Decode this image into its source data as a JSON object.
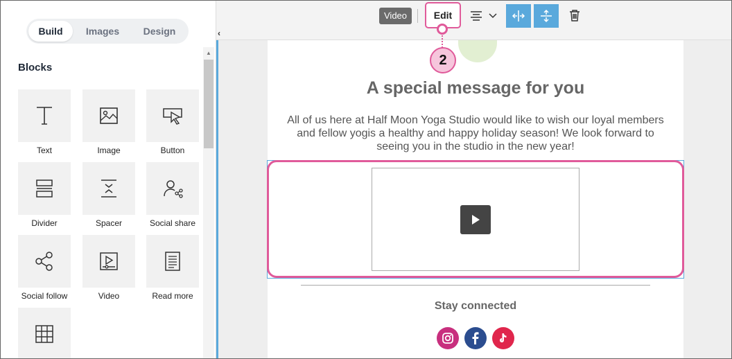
{
  "sidebar": {
    "tabs": [
      {
        "label": "Build",
        "active": true
      },
      {
        "label": "Images",
        "active": false
      },
      {
        "label": "Design",
        "active": false
      }
    ],
    "blocks_title": "Blocks",
    "blocks": [
      {
        "label": "Text",
        "icon": "text-icon"
      },
      {
        "label": "Image",
        "icon": "image-icon"
      },
      {
        "label": "Button",
        "icon": "button-icon"
      },
      {
        "label": "Divider",
        "icon": "divider-icon"
      },
      {
        "label": "Spacer",
        "icon": "spacer-icon"
      },
      {
        "label": "Social share",
        "icon": "social-share-icon"
      },
      {
        "label": "Social follow",
        "icon": "social-follow-icon"
      },
      {
        "label": "Video",
        "icon": "video-icon"
      },
      {
        "label": "Read more",
        "icon": "read-more-icon"
      },
      {
        "label": "",
        "icon": "table-icon"
      }
    ]
  },
  "toolbar": {
    "selected_label": "Video",
    "edit_label": "Edit",
    "align_icon": "align-center-icon",
    "full_width_icon": "horizontal-resize-icon",
    "full_height_icon": "vertical-resize-icon",
    "delete_icon": "trash-icon"
  },
  "callout": {
    "number": "2"
  },
  "email": {
    "headline": "A special message for you",
    "body": "All of us here at Half Moon Yoga Studio would like to wish our loyal members and fellow yogis a healthy and happy holiday season! We look forward to seeing you in the studio in the new year!",
    "stay_connected": "Stay connected",
    "social": [
      "instagram-icon",
      "facebook-icon",
      "tiktok-icon"
    ]
  },
  "colors": {
    "accent_pink": "#e05a9a",
    "selection_blue": "#5aa9dc"
  }
}
